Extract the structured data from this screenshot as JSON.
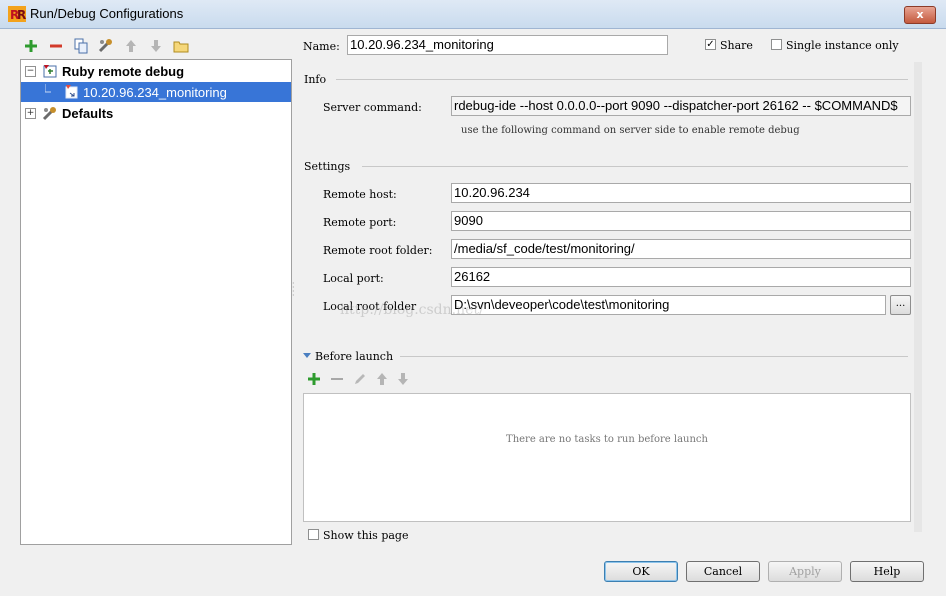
{
  "window": {
    "title": "Run/Debug Configurations",
    "close_label": "x"
  },
  "toolbar": {
    "icons": [
      "add-icon",
      "remove-icon",
      "copy-icon",
      "edit-defaults-icon",
      "move-up-icon",
      "move-down-icon",
      "folder-icon"
    ]
  },
  "tree": {
    "group_label": "Ruby remote debug",
    "config_label": "10.20.96.234_monitoring",
    "defaults_label": "Defaults"
  },
  "form": {
    "name_label": "Name:",
    "name_value": "10.20.96.234_monitoring",
    "share_label": "Share",
    "share_checked": true,
    "single_instance_label": "Single instance only",
    "single_instance_checked": false,
    "info_section": "Info",
    "server_command_label": "Server command:",
    "server_command_value": "rdebug-ide --host 0.0.0.0--port 9090 --dispatcher-port 26162 -- $COMMAND$",
    "server_command_hint": "use the following command on server side to enable remote debug",
    "settings_section": "Settings",
    "remote_host_label": "Remote host:",
    "remote_host_value": "10.20.96.234",
    "remote_port_label": "Remote port:",
    "remote_port_value": "9090",
    "remote_root_label": "Remote root folder:",
    "remote_root_value": "/media/sf_code/test/monitoring/",
    "local_port_label": "Local port:",
    "local_port_value": "26162",
    "local_root_label": "Local root folder",
    "local_root_value": "D:\\svn\\deveoper\\code\\test\\monitoring",
    "browse_label": "..."
  },
  "before_launch": {
    "title": "Before launch",
    "empty_text": "There are no tasks to run before launch",
    "show_page_label": "Show this page"
  },
  "buttons": {
    "ok": "OK",
    "cancel": "Cancel",
    "apply": "Apply",
    "help": "Help"
  },
  "watermark": "http://blog.csdn.net/"
}
